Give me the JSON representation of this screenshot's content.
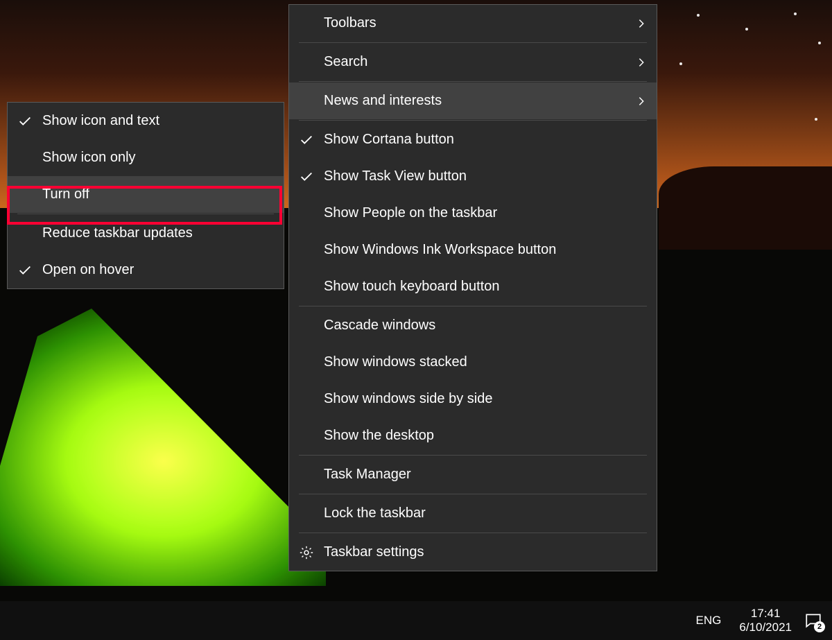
{
  "menu_main": {
    "items": [
      {
        "label": "Toolbars",
        "arrow": true
      },
      {
        "label": "Search",
        "arrow": true
      },
      {
        "label": "News and interests",
        "arrow": true,
        "hover": true
      },
      {
        "label": "Show Cortana button",
        "checked": true
      },
      {
        "label": "Show Task View button",
        "checked": true
      },
      {
        "label": "Show People on the taskbar"
      },
      {
        "label": "Show Windows Ink Workspace button"
      },
      {
        "label": "Show touch keyboard button"
      },
      {
        "label": "Cascade windows"
      },
      {
        "label": "Show windows stacked"
      },
      {
        "label": "Show windows side by side"
      },
      {
        "label": "Show the desktop"
      },
      {
        "label": "Task Manager"
      },
      {
        "label": "Lock the taskbar"
      },
      {
        "label": "Taskbar settings",
        "gear": true
      }
    ],
    "separators_after": [
      0,
      1,
      2,
      7,
      11,
      12,
      13
    ]
  },
  "menu_sub": {
    "items": [
      {
        "label": "Show icon and text",
        "checked": true
      },
      {
        "label": "Show icon only"
      },
      {
        "label": "Turn off",
        "hover": true,
        "highlight": true
      },
      {
        "label": "Reduce taskbar updates"
      },
      {
        "label": "Open on hover",
        "checked": true
      }
    ],
    "separators_after": [
      2
    ]
  },
  "tray": {
    "lang": "ENG",
    "time": "17:41",
    "date": "6/10/2021",
    "badge": "2"
  }
}
